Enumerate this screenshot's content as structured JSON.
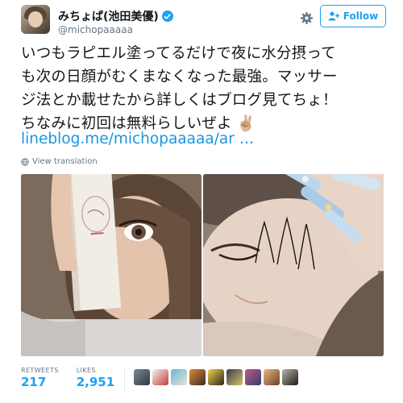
{
  "user": {
    "display_name": "みちょぱ(池田美優)",
    "handle": "@michopaaaaa",
    "avatar_icon": "profile-photo",
    "verified_icon": "verified-badge-icon"
  },
  "header": {
    "follow_label": "Follow",
    "gear_icon": "gear-icon",
    "follow_icon": "add-user-icon"
  },
  "tweet": {
    "lines": [
      "いつもラピエル塗ってるだけで夜に水分摂って",
      "も次の日顔がむくまなくなった最強。マッサー",
      "ジ法とか載せたから詳しくはブログ見てちょ！",
      "ちなみに初回は無料らしいぜよ ✌🏼"
    ],
    "link": "lineblog.me/michopaaaaa/ar …",
    "translate_label": "View translation",
    "translate_icon": "globe-icon"
  },
  "media": [
    {
      "name": "selfie-with-product-photo"
    },
    {
      "name": "face-massage-arrows-photo"
    }
  ],
  "stats": {
    "retweets_label": "RETWEETS",
    "retweets_value": "217",
    "likes_label": "LIKES",
    "likes_value": "2,951"
  },
  "colors": {
    "accent": "#1da1f2",
    "link": "#1b95e0",
    "muted": "#657786"
  }
}
